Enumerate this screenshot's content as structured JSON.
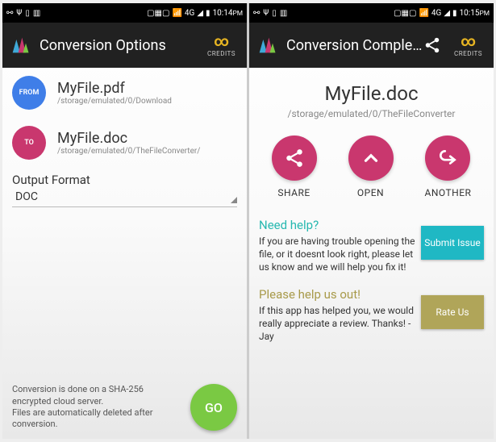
{
  "status": {
    "time1": "10:14",
    "time2": "10:15",
    "ampm": "PM",
    "carrier": "4G"
  },
  "screen1": {
    "header": {
      "title": "Conversion Options",
      "credits_label": "CREDITS",
      "credits_symbol": "∞"
    },
    "from": {
      "badge": "FROM",
      "filename": "MyFile.pdf",
      "path": "/storage/emulated/0/Download"
    },
    "to": {
      "badge": "TO",
      "filename": "MyFile.doc",
      "path": "/storage/emulated/0/TheFileConverter/"
    },
    "output": {
      "label": "Output Format",
      "value": "DOC"
    },
    "footer": {
      "notice_line1": "Conversion is done on a SHA-256 encrypted cloud server.",
      "notice_line2": "Files are automatically deleted after conversion.",
      "go": "GO"
    }
  },
  "screen2": {
    "header": {
      "title": "Conversion Comple...",
      "credits_label": "CREDITS",
      "credits_symbol": "∞"
    },
    "result": {
      "filename": "MyFile.doc",
      "path": "/storage/emulated/0/TheFileConverter"
    },
    "actions": {
      "share": "SHARE",
      "open": "OPEN",
      "another": "ANOTHER"
    },
    "help": {
      "heading": "Need help?",
      "body": "If you are having trouble opening the file, or it doesnt look right, please let us know and we will help you fix it!",
      "button": "Submit Issue"
    },
    "rate": {
      "heading": "Please help us out!",
      "body": "If this app has helped you, we would really appreciate a review. Thanks! - Jay",
      "button": "Rate Us"
    }
  }
}
